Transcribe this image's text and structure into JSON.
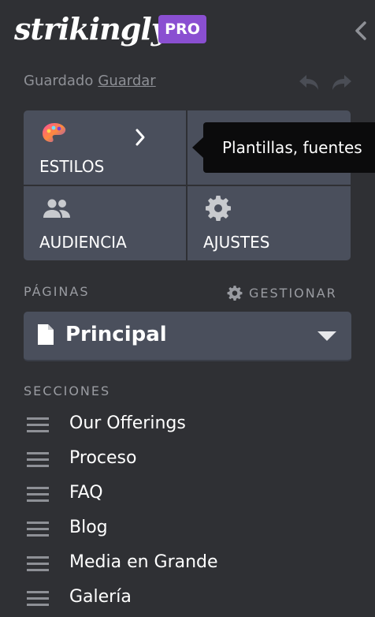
{
  "header": {
    "logo_text": "strikingly",
    "badge": "PRO"
  },
  "save": {
    "status": "Guardado",
    "action": "Guardar"
  },
  "tiles": [
    {
      "label": "ESTILOS",
      "icon": "palette-icon"
    },
    {
      "label": "",
      "icon": "location-pin-icon"
    },
    {
      "label": "AUDIENCIA",
      "icon": "people-icon"
    },
    {
      "label": "AJUSTES",
      "icon": "gear-icon"
    }
  ],
  "tooltip": {
    "text": "Plantillas, fuentes"
  },
  "pages": {
    "title": "PÁGINAS",
    "manage_label": "GESTIONAR",
    "selected": "Principal"
  },
  "sections": {
    "title": "SECCIONES",
    "items": [
      "Our Offerings",
      "Proceso",
      "FAQ",
      "Blog",
      "Media en Grande",
      "Galería"
    ]
  },
  "colors": {
    "background": "#2f3034",
    "tile": "#4a4f5c",
    "badge": "#8a4fd1",
    "muted_text": "#9a9ca2",
    "tooltip": "#0b0b0c"
  }
}
